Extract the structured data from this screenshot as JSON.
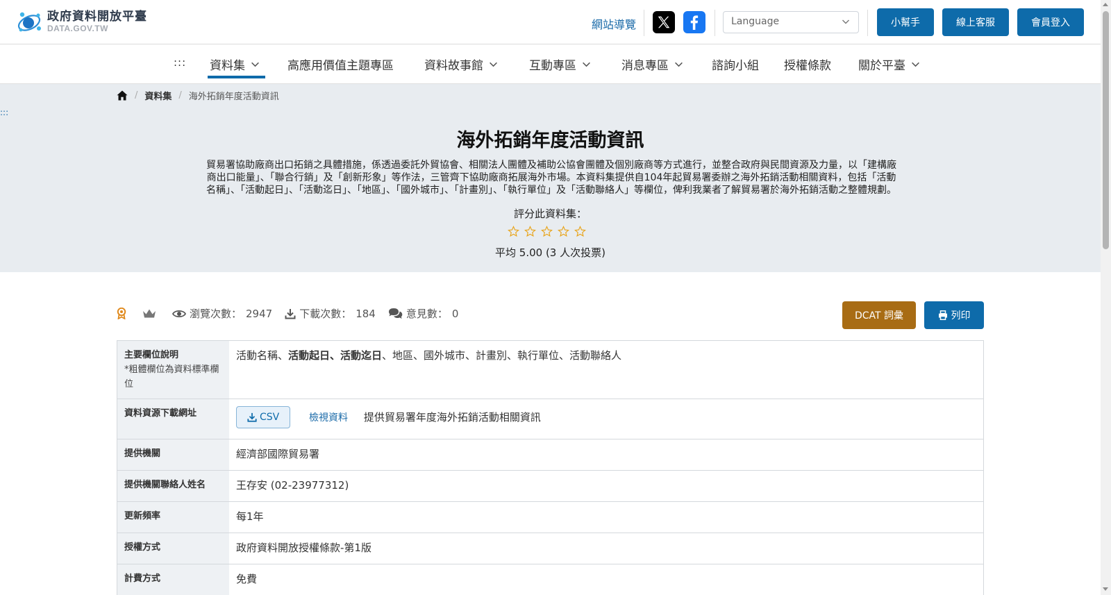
{
  "header": {
    "logo_title": "政府資料開放平臺",
    "logo_sub": "DATA.GOV.TW",
    "sitemap": "網站導覽",
    "language_placeholder": "Language",
    "helper": "小幫手",
    "support": "線上客服",
    "login": "會員登入"
  },
  "nav": {
    "dots": ":::",
    "items": [
      {
        "label": "資料集"
      },
      {
        "label": "高應用價值主題專區"
      },
      {
        "label": "資料故事館"
      },
      {
        "label": "互動專區"
      },
      {
        "label": "消息專區"
      },
      {
        "label": "諮詢小組"
      },
      {
        "label": "授權條款"
      },
      {
        "label": "關於平臺"
      }
    ]
  },
  "breadcrumb": {
    "level1": "資料集",
    "current": "海外拓銷年度活動資訊"
  },
  "side_dots": ":::",
  "dataset": {
    "title": "海外拓銷年度活動資訊",
    "description_lines": [
      "貿易署協助廠商出口拓銷之具體措施，係透過委託外貿協會、相關法人團體及補助公協會團體及個別廠商等方式進行，並整合政府與民間資源及力量，以「建構廠",
      "商出口能量」、「聯合行銷」及「創新形象」等作法，三管齊下協助廠商拓展海外市場。本資料集提供自104年起貿易署委辦之海外拓銷活動相關資料，包括「活動",
      "名稱」、「活動起日」、「活動迄日」、「地區」、「國外城市」、「計畫別」、「執行單位」及「活動聯絡人」等欄位，俾利我業者了解貿易署於海外拓銷活動之整體規劃。"
    ],
    "rating_label": "評分此資料集：",
    "rating_avg": "平均 5.00 (3 人次投票)",
    "star_color": "#e8a317"
  },
  "stats": {
    "views_label": "瀏覽次數：",
    "views": "2947",
    "downloads_label": "下載次數：",
    "downloads": "184",
    "comments_label": "意見數：",
    "comments": "0"
  },
  "actions": {
    "dcat": "DCAT 詞彙",
    "print": "列印"
  },
  "info": {
    "fields_label": "主要欄位說明",
    "fields_note": "*粗體欄位為資料標準欄位",
    "fields_a": "活動名稱、",
    "fields_bold": "活動起日、活動迄日",
    "fields_b": "、地區、國外城市、計畫別、執行單位、活動聯絡人",
    "download_label": "資料資源下載網址",
    "csv": "CSV",
    "view_data": "檢視資料",
    "download_desc": "提供貿易署年度海外拓銷活動相關資訊",
    "provider_label": "提供機關",
    "provider": "經濟部國際貿易署",
    "contact_label": "提供機關聯絡人姓名",
    "contact": "王存安 (02-23977312)",
    "freq_label": "更新頻率",
    "freq": "每1年",
    "license_label": "授權方式",
    "license": "政府資料開放授權條款-第1版",
    "fee_label": "計費方式",
    "fee": "免費"
  }
}
